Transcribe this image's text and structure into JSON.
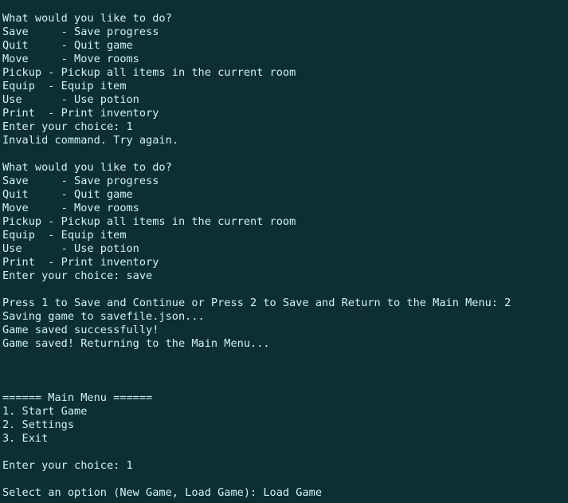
{
  "terminal": {
    "lines": [
      "What would you like to do?",
      "Save     - Save progress",
      "Quit     - Quit game",
      "Move     - Move rooms",
      "Pickup - Pickup all items in the current room",
      "Equip  - Equip item",
      "Use      - Use potion",
      "Print  - Print inventory",
      "Enter your choice: 1",
      "Invalid command. Try again.",
      "",
      "What would you like to do?",
      "Save     - Save progress",
      "Quit     - Quit game",
      "Move     - Move rooms",
      "Pickup - Pickup all items in the current room",
      "Equip  - Equip item",
      "Use      - Use potion",
      "Print  - Print inventory",
      "Enter your choice: save",
      "",
      "Press 1 to Save and Continue or Press 2 to Save and Return to the Main Menu: 2",
      "Saving game to savefile.json...",
      "Game saved successfully!",
      "Game saved! Returning to the Main Menu...",
      "",
      "",
      "",
      "====== Main Menu ======",
      "1. Start Game",
      "2. Settings",
      "3. Exit",
      "",
      "Enter your choice: 1",
      "",
      "Select an option (New Game, Load Game): Load Game"
    ],
    "colors": {
      "background": "#0b2f33",
      "foreground": "#d4f2f0"
    }
  }
}
